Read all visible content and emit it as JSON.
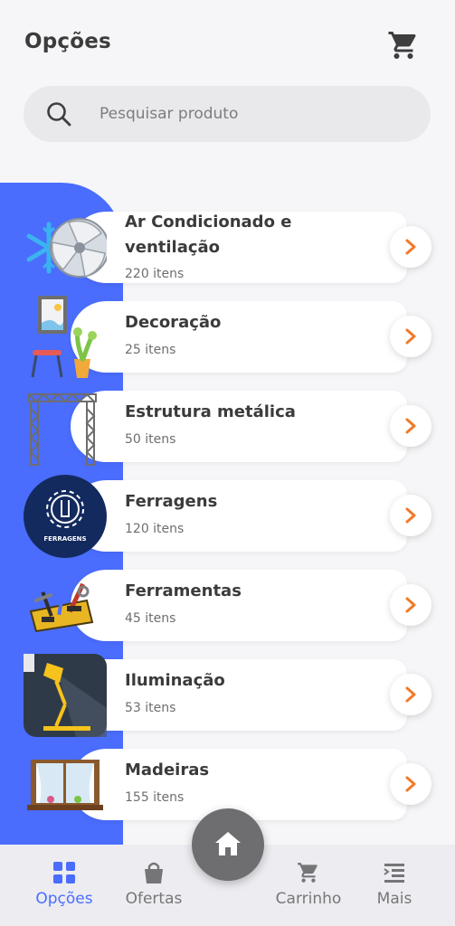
{
  "header": {
    "title": "Opções",
    "cart_icon": "cart-icon"
  },
  "search": {
    "placeholder": "Pesquisar produto",
    "value": ""
  },
  "colors": {
    "accent": "#4a6dfd",
    "arrow": "#f07a2a",
    "home_fab": "#6e6e70"
  },
  "categories": [
    {
      "name": "Ar Condicionado e ventilação",
      "count": "220 itens",
      "icon": "air-conditioning-fan-icon"
    },
    {
      "name": "Decoração",
      "count": "25 itens",
      "icon": "decoration-icon"
    },
    {
      "name": "Estrutura metálica",
      "count": "50 itens",
      "icon": "metal-truss-icon"
    },
    {
      "name": "Ferragens",
      "count": "120 itens",
      "icon": "ferragens-gear-wrench-icon",
      "badge_text": "FERRAGENS"
    },
    {
      "name": "Ferramentas",
      "count": "45 itens",
      "icon": "tools-icon"
    },
    {
      "name": "Iluminação",
      "count": "53 itens",
      "icon": "desk-lamp-icon"
    },
    {
      "name": "Madeiras",
      "count": "155 itens",
      "icon": "wooden-window-icon"
    }
  ],
  "bottom_nav": {
    "items": [
      {
        "label": "Opções",
        "icon": "grid-icon",
        "active": true
      },
      {
        "label": "Ofertas",
        "icon": "shopping-bag-icon",
        "active": false
      },
      {
        "label": "Carrinho",
        "icon": "cart-icon",
        "active": false
      },
      {
        "label": "Mais",
        "icon": "menu-list-icon",
        "active": false
      }
    ],
    "home": {
      "icon": "home-icon"
    }
  }
}
